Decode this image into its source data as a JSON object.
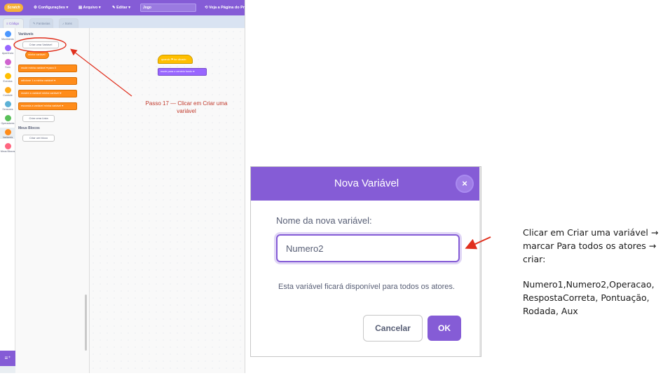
{
  "editor": {
    "logo": "Scratch",
    "menu": {
      "settings": "Configurações",
      "file": "Arquivo",
      "edit": "Editar",
      "project_name": "Jogo",
      "see_project": "Veja a Página do Pr"
    },
    "tabs": [
      {
        "label": "Código"
      },
      {
        "label": "Fantasias"
      },
      {
        "label": "Sons"
      }
    ],
    "categories": [
      {
        "label": "Movimento",
        "color": "#4c97ff"
      },
      {
        "label": "Aparência",
        "color": "#9966ff"
      },
      {
        "label": "Som",
        "color": "#cf63cf"
      },
      {
        "label": "Eventos",
        "color": "#ffbf00"
      },
      {
        "label": "Controle",
        "color": "#ffab19"
      },
      {
        "label": "Sensores",
        "color": "#5cb1d6"
      },
      {
        "label": "Operadores",
        "color": "#59c059"
      },
      {
        "label": "Variáveis",
        "color": "#ff8c1a"
      },
      {
        "label": "Meus Blocos",
        "color": "#ff6680"
      }
    ],
    "palette": {
      "variables_heading": "Variáveis",
      "create_variable": "Criar uma Variável",
      "reporter": "minha variável",
      "blocks": [
        {
          "text": "mude  minha variável ▾  para  0"
        },
        {
          "text": "adicione  1  a  minha variável ▾"
        },
        {
          "text": "mostre a variável  minha variável ▾"
        },
        {
          "text": "esconda a variável  minha variável ▾"
        }
      ],
      "create_list": "Criar uma Lista",
      "my_blocks_heading": "Meus Blocos",
      "create_block": "Criar um bloco"
    },
    "workspace": {
      "hat_block": "quando ⚑ for clicado",
      "looks_block": "mude para o cenário  fundo ▾"
    }
  },
  "annotation_step17": "Passo 17 — Clicar em Criar uma variável",
  "dialog": {
    "title": "Nova Variável",
    "close_symbol": "×",
    "prompt": "Nome da nova variável:",
    "input_value": "Numero2",
    "hint": "Esta variável ficará disponível para todos os atores.",
    "cancel": "Cancelar",
    "ok": "OK"
  },
  "instructions": {
    "line1": "Clicar em Criar uma variável → marcar Para todos os atores → criar:",
    "line2": "Numero1,Numero2,Operacao, RespostaCorreta, Pontuação, Rodada, Aux"
  },
  "colors": {
    "scratch_purple": "#855cd6",
    "variables_orange": "#ff8c1a",
    "annotation_red": "#e0301e"
  }
}
